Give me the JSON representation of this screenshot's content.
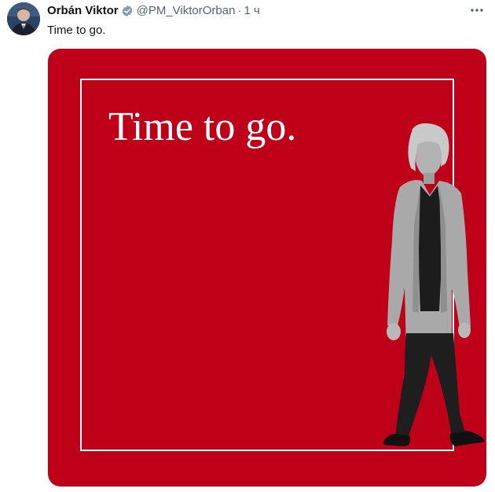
{
  "tweet": {
    "author": {
      "display_name": "Orbán Viktor",
      "handle": "@PM_ViktorOrban",
      "verified": true,
      "avatar_icon": "person-avatar-icon"
    },
    "separator": "·",
    "timestamp": "1 ч",
    "text": "Time to go.",
    "more_icon": "more-options-icon",
    "media": {
      "background_color": "#be0019",
      "headline": "Time to go.",
      "figure": "walking-woman-figure"
    }
  }
}
